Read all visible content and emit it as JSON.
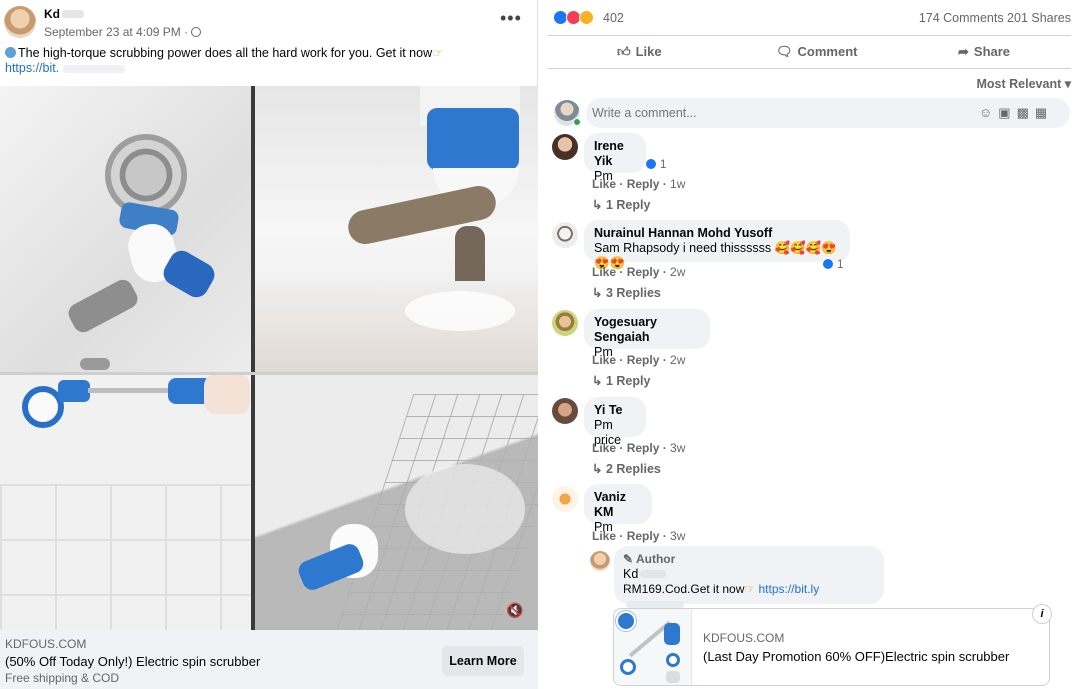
{
  "post": {
    "author": "Kd",
    "date": "September 23 at 4:09 PM ·",
    "more": "•••",
    "caption": "The high-torque scrubbing power does all the hard work for you. Get it now",
    "caption_link": "https://bit.",
    "volume_icon": "speaker-icon"
  },
  "link_preview": {
    "domain": "KDFOUS.COM",
    "title": "(50% Off Today Only!) Electric spin scrubber",
    "subtitle": "Free shipping & COD",
    "cta": "Learn More"
  },
  "stats": {
    "reactions": "402",
    "comments_shares": "174 Comments  201 Shares"
  },
  "actions": {
    "like": "Like",
    "comment": "Comment",
    "share": "Share"
  },
  "sort": "Most Relevant ▾",
  "comment_box": {
    "placeholder": "Write a comment..."
  },
  "comments": [
    {
      "name": "Irene Yik",
      "text": "Pm",
      "reactions": "1",
      "like": "Like",
      "reply": "Reply",
      "time": "1w",
      "replies": "1 Reply"
    },
    {
      "name": "Nurainul Hannan Mohd Yusoff",
      "text": "Sam Rhapsody i need thissssss 🥰🥰🥰😍😍😍",
      "reactions": "1",
      "like": "Like",
      "reply": "Reply",
      "time": "2w",
      "replies": "3 Replies"
    },
    {
      "name": "Yogesuary Sengaiah",
      "text": "Pm",
      "like": "Like",
      "reply": "Reply",
      "time": "2w",
      "replies": "1 Reply"
    },
    {
      "name": "Yi Te",
      "text": "Pm price",
      "like": "Like",
      "reply": "Reply",
      "time": "3w",
      "replies": "2 Replies"
    },
    {
      "name": "Vaniz KM",
      "text": "Pm",
      "like": "Like",
      "reply": "Reply",
      "time": "3w"
    }
  ],
  "author_reply": {
    "badge": "Author",
    "name": "Kd",
    "text": "RM169.Cod.Get it now",
    "link": "https://bit.ly"
  },
  "reply_card": {
    "domain": "KDFOUS.COM",
    "title": "(Last Day Promotion 60% OFF)Electric spin scrubber",
    "info": "i"
  },
  "colors": {
    "accent": "#1877f2",
    "link": "#216fdb",
    "meta": "#65676b"
  }
}
